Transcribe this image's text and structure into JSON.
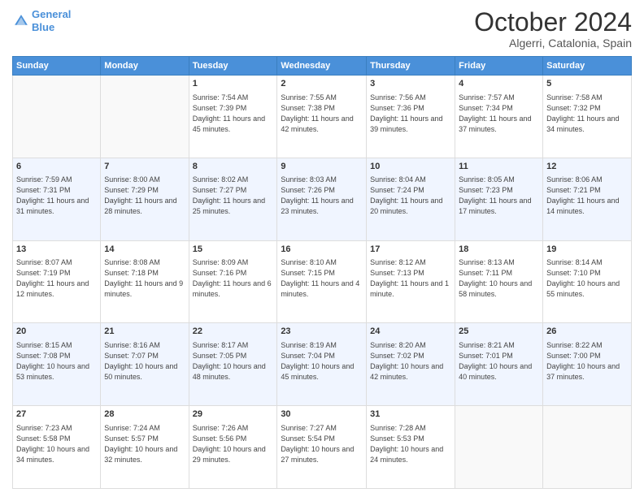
{
  "header": {
    "logo_line1": "General",
    "logo_line2": "Blue",
    "month": "October 2024",
    "location": "Algerri, Catalonia, Spain"
  },
  "weekdays": [
    "Sunday",
    "Monday",
    "Tuesday",
    "Wednesday",
    "Thursday",
    "Friday",
    "Saturday"
  ],
  "weeks": [
    [
      {
        "day": "",
        "sunrise": "",
        "sunset": "",
        "daylight": ""
      },
      {
        "day": "",
        "sunrise": "",
        "sunset": "",
        "daylight": ""
      },
      {
        "day": "1",
        "sunrise": "Sunrise: 7:54 AM",
        "sunset": "Sunset: 7:39 PM",
        "daylight": "Daylight: 11 hours and 45 minutes."
      },
      {
        "day": "2",
        "sunrise": "Sunrise: 7:55 AM",
        "sunset": "Sunset: 7:38 PM",
        "daylight": "Daylight: 11 hours and 42 minutes."
      },
      {
        "day": "3",
        "sunrise": "Sunrise: 7:56 AM",
        "sunset": "Sunset: 7:36 PM",
        "daylight": "Daylight: 11 hours and 39 minutes."
      },
      {
        "day": "4",
        "sunrise": "Sunrise: 7:57 AM",
        "sunset": "Sunset: 7:34 PM",
        "daylight": "Daylight: 11 hours and 37 minutes."
      },
      {
        "day": "5",
        "sunrise": "Sunrise: 7:58 AM",
        "sunset": "Sunset: 7:32 PM",
        "daylight": "Daylight: 11 hours and 34 minutes."
      }
    ],
    [
      {
        "day": "6",
        "sunrise": "Sunrise: 7:59 AM",
        "sunset": "Sunset: 7:31 PM",
        "daylight": "Daylight: 11 hours and 31 minutes."
      },
      {
        "day": "7",
        "sunrise": "Sunrise: 8:00 AM",
        "sunset": "Sunset: 7:29 PM",
        "daylight": "Daylight: 11 hours and 28 minutes."
      },
      {
        "day": "8",
        "sunrise": "Sunrise: 8:02 AM",
        "sunset": "Sunset: 7:27 PM",
        "daylight": "Daylight: 11 hours and 25 minutes."
      },
      {
        "day": "9",
        "sunrise": "Sunrise: 8:03 AM",
        "sunset": "Sunset: 7:26 PM",
        "daylight": "Daylight: 11 hours and 23 minutes."
      },
      {
        "day": "10",
        "sunrise": "Sunrise: 8:04 AM",
        "sunset": "Sunset: 7:24 PM",
        "daylight": "Daylight: 11 hours and 20 minutes."
      },
      {
        "day": "11",
        "sunrise": "Sunrise: 8:05 AM",
        "sunset": "Sunset: 7:23 PM",
        "daylight": "Daylight: 11 hours and 17 minutes."
      },
      {
        "day": "12",
        "sunrise": "Sunrise: 8:06 AM",
        "sunset": "Sunset: 7:21 PM",
        "daylight": "Daylight: 11 hours and 14 minutes."
      }
    ],
    [
      {
        "day": "13",
        "sunrise": "Sunrise: 8:07 AM",
        "sunset": "Sunset: 7:19 PM",
        "daylight": "Daylight: 11 hours and 12 minutes."
      },
      {
        "day": "14",
        "sunrise": "Sunrise: 8:08 AM",
        "sunset": "Sunset: 7:18 PM",
        "daylight": "Daylight: 11 hours and 9 minutes."
      },
      {
        "day": "15",
        "sunrise": "Sunrise: 8:09 AM",
        "sunset": "Sunset: 7:16 PM",
        "daylight": "Daylight: 11 hours and 6 minutes."
      },
      {
        "day": "16",
        "sunrise": "Sunrise: 8:10 AM",
        "sunset": "Sunset: 7:15 PM",
        "daylight": "Daylight: 11 hours and 4 minutes."
      },
      {
        "day": "17",
        "sunrise": "Sunrise: 8:12 AM",
        "sunset": "Sunset: 7:13 PM",
        "daylight": "Daylight: 11 hours and 1 minute."
      },
      {
        "day": "18",
        "sunrise": "Sunrise: 8:13 AM",
        "sunset": "Sunset: 7:11 PM",
        "daylight": "Daylight: 10 hours and 58 minutes."
      },
      {
        "day": "19",
        "sunrise": "Sunrise: 8:14 AM",
        "sunset": "Sunset: 7:10 PM",
        "daylight": "Daylight: 10 hours and 55 minutes."
      }
    ],
    [
      {
        "day": "20",
        "sunrise": "Sunrise: 8:15 AM",
        "sunset": "Sunset: 7:08 PM",
        "daylight": "Daylight: 10 hours and 53 minutes."
      },
      {
        "day": "21",
        "sunrise": "Sunrise: 8:16 AM",
        "sunset": "Sunset: 7:07 PM",
        "daylight": "Daylight: 10 hours and 50 minutes."
      },
      {
        "day": "22",
        "sunrise": "Sunrise: 8:17 AM",
        "sunset": "Sunset: 7:05 PM",
        "daylight": "Daylight: 10 hours and 48 minutes."
      },
      {
        "day": "23",
        "sunrise": "Sunrise: 8:19 AM",
        "sunset": "Sunset: 7:04 PM",
        "daylight": "Daylight: 10 hours and 45 minutes."
      },
      {
        "day": "24",
        "sunrise": "Sunrise: 8:20 AM",
        "sunset": "Sunset: 7:02 PM",
        "daylight": "Daylight: 10 hours and 42 minutes."
      },
      {
        "day": "25",
        "sunrise": "Sunrise: 8:21 AM",
        "sunset": "Sunset: 7:01 PM",
        "daylight": "Daylight: 10 hours and 40 minutes."
      },
      {
        "day": "26",
        "sunrise": "Sunrise: 8:22 AM",
        "sunset": "Sunset: 7:00 PM",
        "daylight": "Daylight: 10 hours and 37 minutes."
      }
    ],
    [
      {
        "day": "27",
        "sunrise": "Sunrise: 7:23 AM",
        "sunset": "Sunset: 5:58 PM",
        "daylight": "Daylight: 10 hours and 34 minutes."
      },
      {
        "day": "28",
        "sunrise": "Sunrise: 7:24 AM",
        "sunset": "Sunset: 5:57 PM",
        "daylight": "Daylight: 10 hours and 32 minutes."
      },
      {
        "day": "29",
        "sunrise": "Sunrise: 7:26 AM",
        "sunset": "Sunset: 5:56 PM",
        "daylight": "Daylight: 10 hours and 29 minutes."
      },
      {
        "day": "30",
        "sunrise": "Sunrise: 7:27 AM",
        "sunset": "Sunset: 5:54 PM",
        "daylight": "Daylight: 10 hours and 27 minutes."
      },
      {
        "day": "31",
        "sunrise": "Sunrise: 7:28 AM",
        "sunset": "Sunset: 5:53 PM",
        "daylight": "Daylight: 10 hours and 24 minutes."
      },
      {
        "day": "",
        "sunrise": "",
        "sunset": "",
        "daylight": ""
      },
      {
        "day": "",
        "sunrise": "",
        "sunset": "",
        "daylight": ""
      }
    ]
  ]
}
